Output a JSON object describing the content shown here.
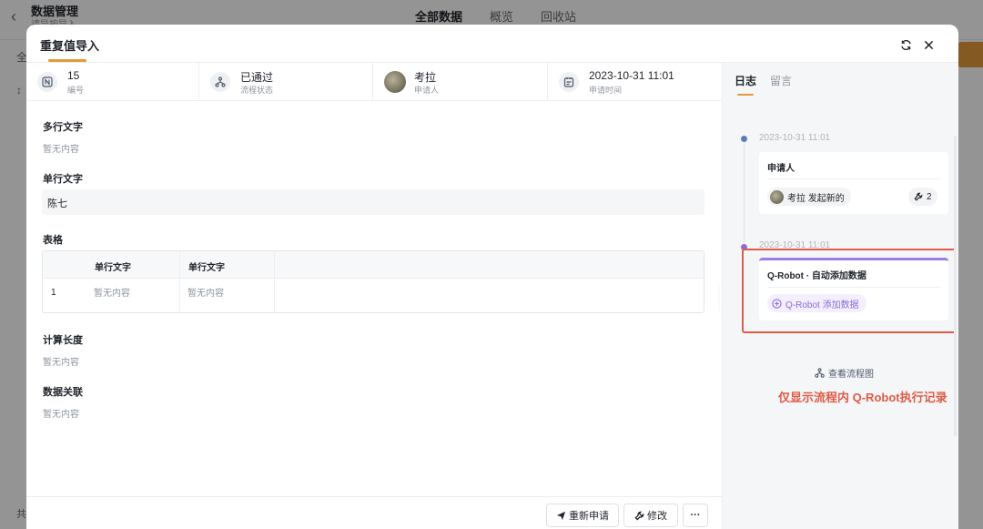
{
  "background": {
    "title": "数据管理",
    "subtitle": "请导按导入",
    "tabs": [
      "全部数据",
      "概览",
      "回收站"
    ],
    "side_a": "全",
    "side_b": "↕",
    "side_c": "共"
  },
  "modal": {
    "title": "重复值导入"
  },
  "info_bar": {
    "number": {
      "value": "15",
      "label": "编号"
    },
    "status": {
      "value": "已通过",
      "label": "流程状态"
    },
    "applicant": {
      "value": "考拉",
      "label": "申请人"
    },
    "time": {
      "value": "2023-10-31 11:01",
      "label": "申请时间"
    }
  },
  "fields": {
    "multiline": {
      "label": "多行文字",
      "value": "暂无内容"
    },
    "singleline": {
      "label": "单行文字",
      "value": "陈七"
    },
    "table": {
      "label": "表格",
      "columns": [
        "单行文字",
        "单行文字"
      ],
      "rows": [
        {
          "index": "1",
          "cells": [
            "暂无内容",
            "暂无内容"
          ]
        }
      ]
    },
    "calc": {
      "label": "计算长度",
      "value": "暂无内容"
    },
    "relation": {
      "label": "数据关联",
      "value": "暂无内容"
    }
  },
  "footer": {
    "reapply": "重新申请",
    "edit": "修改",
    "more": "···"
  },
  "right_panel": {
    "tabs": [
      "日志",
      "留言"
    ],
    "entries": [
      {
        "time": "2023-10-31 11:01",
        "title": "申请人",
        "chip_text": "考拉 发起新的",
        "count": "2",
        "dot_color": "#5b7fb0"
      },
      {
        "time": "2023-10-31 11:01",
        "title": "Q-Robot · 自动添加数据",
        "chip_text": "Q-Robot 添加数据",
        "dot_color": "#8e6bd8",
        "accent_color": "#9b7be6"
      }
    ],
    "view_flow": "查看流程图",
    "annotation": "仅显示流程内 Q-Robot执行记录"
  }
}
